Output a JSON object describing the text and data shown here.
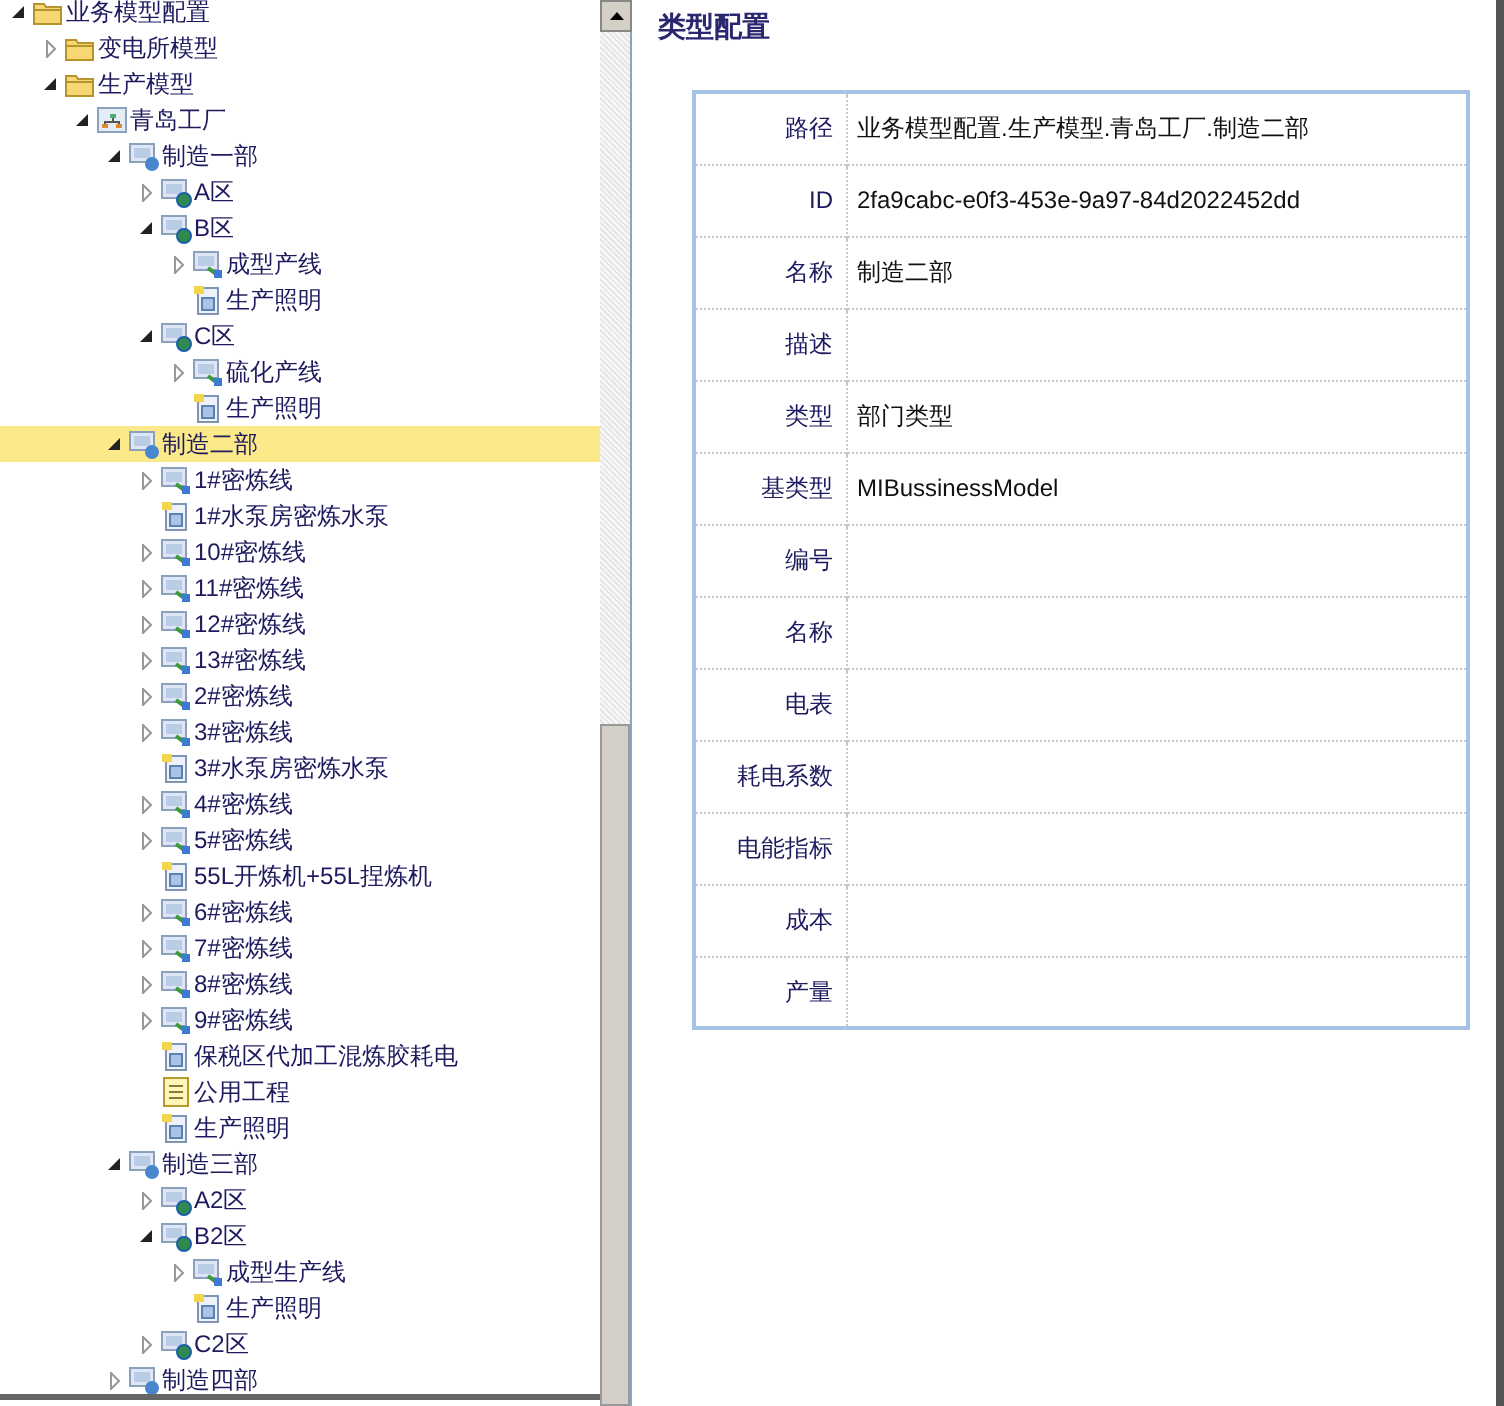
{
  "tree": [
    {
      "label": "业务模型配置",
      "kind": "folder",
      "expanded": true,
      "selected": false,
      "children": [
        {
          "label": "变电所模型",
          "kind": "folder",
          "expanded": false,
          "selected": false
        },
        {
          "label": "生产模型",
          "kind": "folder",
          "expanded": true,
          "selected": false,
          "children": [
            {
              "label": "青岛工厂",
              "kind": "factory",
              "expanded": true,
              "selected": false,
              "children": [
                {
                  "label": "制造一部",
                  "kind": "dept",
                  "expanded": true,
                  "selected": false,
                  "children": [
                    {
                      "label": "A区",
                      "kind": "area",
                      "expanded": false,
                      "selected": false
                    },
                    {
                      "label": "B区",
                      "kind": "area",
                      "expanded": true,
                      "selected": false,
                      "children": [
                        {
                          "label": "成型产线",
                          "kind": "line",
                          "expanded": false,
                          "selected": false
                        },
                        {
                          "label": "生产照明",
                          "kind": "meter",
                          "selected": false
                        }
                      ]
                    },
                    {
                      "label": "C区",
                      "kind": "area",
                      "expanded": true,
                      "selected": false,
                      "children": [
                        {
                          "label": "硫化产线",
                          "kind": "line",
                          "expanded": false,
                          "selected": false
                        },
                        {
                          "label": "生产照明",
                          "kind": "meter",
                          "selected": false
                        }
                      ]
                    }
                  ]
                },
                {
                  "label": "制造二部",
                  "kind": "dept",
                  "expanded": true,
                  "selected": true,
                  "children": [
                    {
                      "label": "1#密炼线",
                      "kind": "line",
                      "expanded": false,
                      "selected": false
                    },
                    {
                      "label": "1#水泵房密炼水泵",
                      "kind": "meter",
                      "selected": false
                    },
                    {
                      "label": "10#密炼线",
                      "kind": "line",
                      "expanded": false,
                      "selected": false
                    },
                    {
                      "label": "11#密炼线",
                      "kind": "line",
                      "expanded": false,
                      "selected": false
                    },
                    {
                      "label": "12#密炼线",
                      "kind": "line",
                      "expanded": false,
                      "selected": false
                    },
                    {
                      "label": "13#密炼线",
                      "kind": "line",
                      "expanded": false,
                      "selected": false
                    },
                    {
                      "label": "2#密炼线",
                      "kind": "line",
                      "expanded": false,
                      "selected": false
                    },
                    {
                      "label": "3#密炼线",
                      "kind": "line",
                      "expanded": false,
                      "selected": false
                    },
                    {
                      "label": "3#水泵房密炼水泵",
                      "kind": "meter",
                      "selected": false
                    },
                    {
                      "label": "4#密炼线",
                      "kind": "line",
                      "expanded": false,
                      "selected": false
                    },
                    {
                      "label": "5#密炼线",
                      "kind": "line",
                      "expanded": false,
                      "selected": false
                    },
                    {
                      "label": "55L开炼机+55L捏炼机",
                      "kind": "meter",
                      "selected": false
                    },
                    {
                      "label": "6#密炼线",
                      "kind": "line",
                      "expanded": false,
                      "selected": false
                    },
                    {
                      "label": "7#密炼线",
                      "kind": "line",
                      "expanded": false,
                      "selected": false
                    },
                    {
                      "label": "8#密炼线",
                      "kind": "line",
                      "expanded": false,
                      "selected": false
                    },
                    {
                      "label": "9#密炼线",
                      "kind": "line",
                      "expanded": false,
                      "selected": false
                    },
                    {
                      "label": "保税区代加工混炼胶耗电",
                      "kind": "meter",
                      "selected": false
                    },
                    {
                      "label": "公用工程",
                      "kind": "note",
                      "selected": false
                    },
                    {
                      "label": "生产照明",
                      "kind": "meter",
                      "selected": false
                    }
                  ]
                },
                {
                  "label": "制造三部",
                  "kind": "dept",
                  "expanded": true,
                  "selected": false,
                  "children": [
                    {
                      "label": "A2区",
                      "kind": "area",
                      "expanded": false,
                      "selected": false
                    },
                    {
                      "label": "B2区",
                      "kind": "area",
                      "expanded": true,
                      "selected": false,
                      "children": [
                        {
                          "label": "成型生产线",
                          "kind": "line",
                          "expanded": false,
                          "selected": false
                        },
                        {
                          "label": "生产照明",
                          "kind": "meter",
                          "selected": false
                        }
                      ]
                    },
                    {
                      "label": "C2区",
                      "kind": "area",
                      "expanded": false,
                      "selected": false
                    }
                  ]
                },
                {
                  "label": "制造四部",
                  "kind": "dept",
                  "expanded": false,
                  "selected": false
                }
              ]
            }
          ]
        }
      ]
    }
  ],
  "panel": {
    "title": "类型配置",
    "fields": [
      {
        "label": "路径",
        "value": "业务模型配置.生产模型.青岛工厂.制造二部"
      },
      {
        "label": "ID",
        "value": "2fa9cabc-e0f3-453e-9a97-84d2022452dd"
      },
      {
        "label": "名称",
        "value": "制造二部"
      },
      {
        "label": "描述"
      },
      {
        "label": "类型",
        "value": "部门类型"
      },
      {
        "label": "基类型",
        "value": "MIBussinessModel"
      },
      {
        "label": "编号"
      },
      {
        "label": "名称"
      },
      {
        "label": "电表"
      },
      {
        "label": "耗电系数"
      },
      {
        "label": "电能指标"
      },
      {
        "label": "成本"
      },
      {
        "label": "产量"
      }
    ]
  }
}
